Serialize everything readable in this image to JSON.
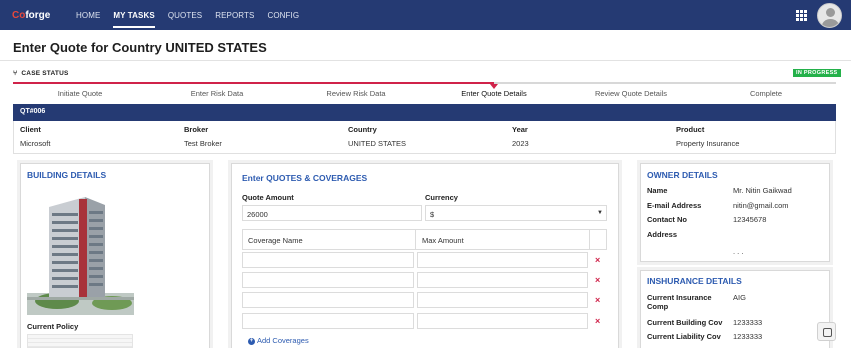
{
  "brand": {
    "logo_prefix": "Co",
    "logo_rest": "forge"
  },
  "nav": {
    "items": [
      "HOME",
      "MY TASKS",
      "QUOTES",
      "REPORTS",
      "CONFIG"
    ],
    "active": "MY TASKS"
  },
  "page": {
    "title": "Enter Quote for Country UNITED STATES"
  },
  "case_status": {
    "label": "CASE STATUS",
    "badge": "IN PROGRESS",
    "steps": [
      "Initiate Quote",
      "Enter Risk Data",
      "Review Risk Data",
      "Enter Quote Details",
      "Review Quote Details",
      "Complete"
    ],
    "current_step": "Enter Quote Details"
  },
  "quote": {
    "id": "QT#006",
    "client_label": "Client",
    "client": "Microsoft",
    "broker_label": "Broker",
    "broker": "Test Broker",
    "country_label": "Country",
    "country": "UNITED STATES",
    "year_label": "Year",
    "year": "2023",
    "product_label": "Product",
    "product": "Property Insurance"
  },
  "building": {
    "title": "BUILDING DETAILS",
    "current_policy_label": "Current Policy"
  },
  "quotes_form": {
    "title": "Enter QUOTES & COVERAGES",
    "quote_amount_label": "Quote Amount",
    "quote_amount_value": "26000",
    "currency_label": "Currency",
    "currency_value": "$",
    "coverage_name_header": "Coverage Name",
    "max_amount_header": "Max Amount",
    "add_coverages": "Add Coverages",
    "delete_icon_glyph": "×"
  },
  "owner": {
    "title": "OWNER DETAILS",
    "name_label": "Name",
    "name": "Mr. Nitin Gaikwad",
    "email_label": "E-mail Address",
    "email": "nitin@gmail.com",
    "contact_label": "Contact No",
    "contact": "12345678",
    "address_label": "Address",
    "address": ". . ."
  },
  "insurance": {
    "title": "INSHURANCE DETAILS",
    "company_label_1": "Current Insurance",
    "company_label_2": "Comp",
    "company": "AIG",
    "building_cov_label": "Current Building Cov",
    "building_cov": "1233333",
    "liability_cov_label": "Current Liability Cov",
    "liability_cov": "1233333"
  },
  "colors": {
    "navy": "#253a73",
    "accent_red": "#d0234a",
    "status_green": "#24b14a",
    "link_blue": "#2d5bb0"
  },
  "icons": [
    "apps-grid-icon",
    "user-avatar-icon",
    "case-status-icon",
    "delete-row-icon",
    "add-circle-icon",
    "dropdown-caret-icon",
    "floating-action-icon"
  ]
}
